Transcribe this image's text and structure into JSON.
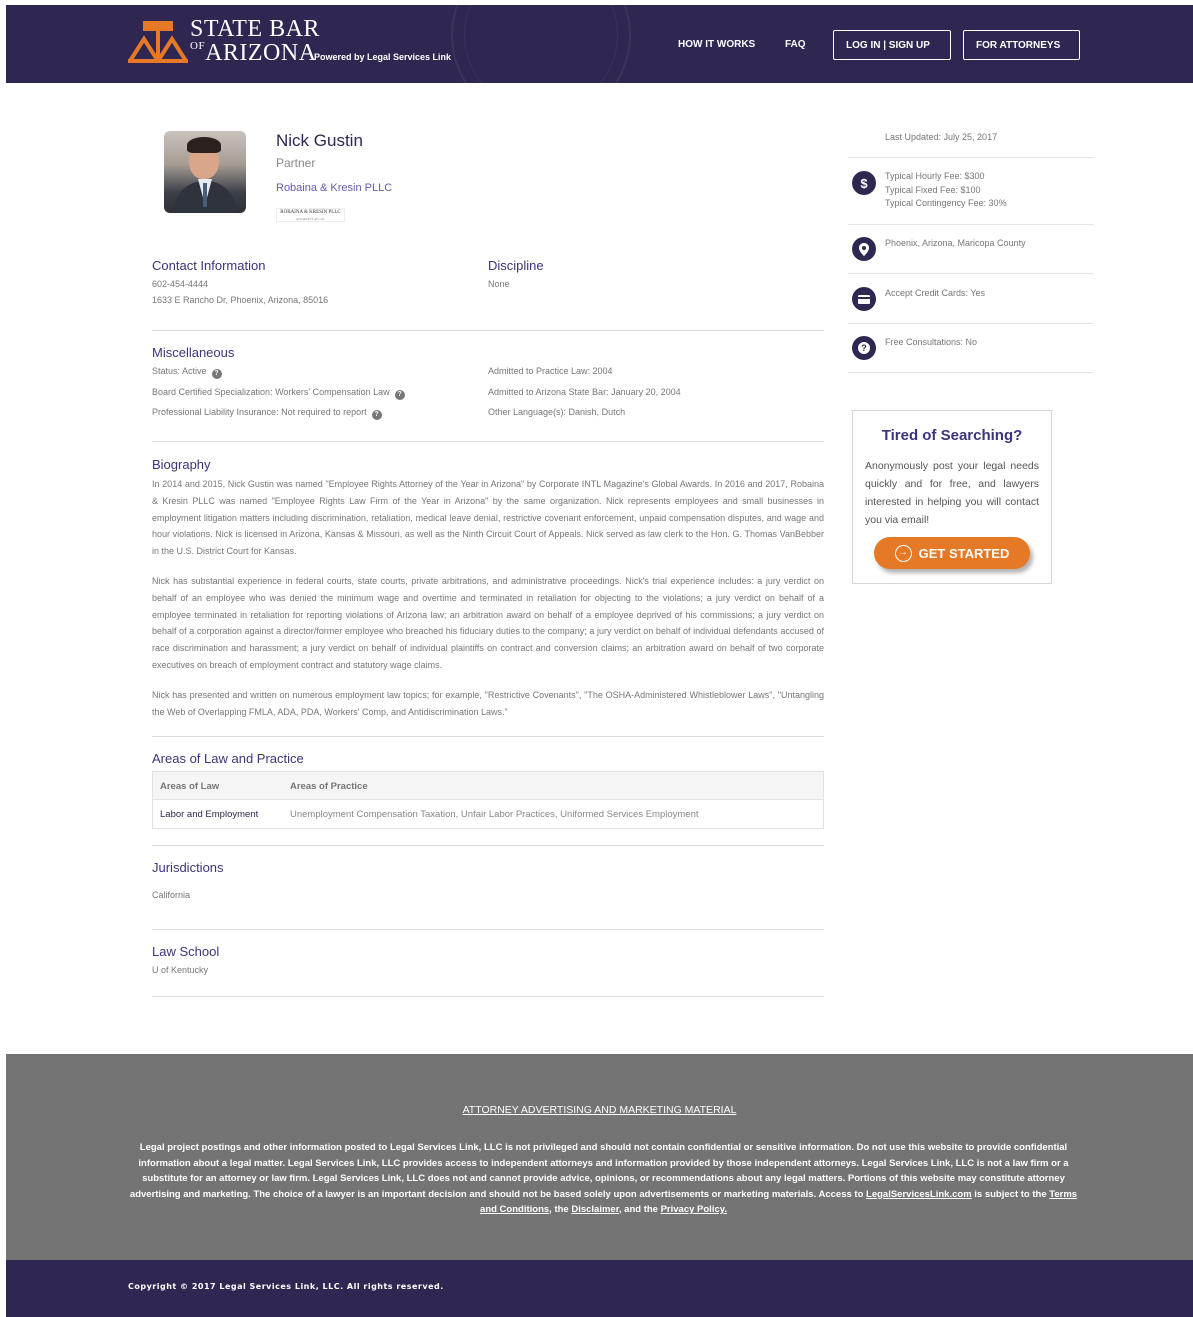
{
  "header": {
    "logo_line1": "STATE BAR",
    "logo_of": "OF",
    "logo_line2": "ARIZONA",
    "powered_by": "Powered by Legal Services Link",
    "nav_how": "HOW IT WORKS",
    "nav_faq": "FAQ",
    "login_label": "LOG IN | SIGN UP",
    "attorney_label": "FOR ATTORNEYS",
    "accent": "#2f2751"
  },
  "profile": {
    "name": "Nick Gustin",
    "role": "Partner",
    "firm": "Robaina & Kresin PLLC",
    "firm_logo_text": "ROBAINA & KRESIN PLLC",
    "firm_logo_sub": "ATTORNEYS AT LAW"
  },
  "contact": {
    "title": "Contact Information",
    "phone": "602-454-4444",
    "address": "1633 E Rancho Dr, Phoenix, Arizona, 85016"
  },
  "discipline": {
    "title": "Discipline",
    "value": "None"
  },
  "misc": {
    "title": "Miscellaneous",
    "status": "Status: Active",
    "certified": "Board Certified Specialization: Workers' Compensation Law",
    "insurance": "Professional Liability Insurance: Not required to report",
    "admitted_practice": "Admitted to Practice Law: 2004",
    "admitted_bar": "Admitted to Arizona State Bar: January 20, 2004",
    "languages": "Other Language(s): Danish, Dutch"
  },
  "biography": {
    "title": "Biography",
    "p1": "In 2014 and 2015, Nick Gustin was named \"Employee Rights Attorney of the Year in Arizona\" by Corporate INTL Magazine's Global Awards. In 2016 and 2017, Robaina & Kresin PLLC was named \"Employee Rights Law Firm of the Year in Arizona\" by the same organization.  Nick represents employees and small businesses in employment litigation matters including discrimination, retaliation, medical leave denial, restrictive covenant enforcement, unpaid compensation disputes, and wage and hour violations. Nick is licensed in Arizona, Kansas & Missouri, as well as the Ninth Circuit Court of Appeals. Nick served as law clerk to the Hon. G. Thomas VanBebber in the U.S. District Court for Kansas.",
    "p2": "Nick has substantial experience in federal courts, state courts, private arbitrations, and administrative proceedings. Nick's trial experience includes: a jury verdict on behalf of an employee who was denied the minimum wage and overtime and terminated in retaliation for objecting to the violations; a jury verdict on behalf of a employee terminated in retaliation for reporting violations of Arizona law; an arbitration award on behalf of a employee deprived of his commissions; a jury verdict on behalf of a corporation against a director/former employee who breached his fiduciary duties to the company; a jury verdict on behalf of individual defendants accused of race discrimination and harassment; a jury verdict on behalf of individual plaintiffs on contract and conversion claims; an arbitration award on behalf of two corporate executives on breach of employment contract and statutory wage claims.",
    "p3": "Nick has presented and written on numerous employment law topics; for example, \"Restrictive Covenants\", \"The OSHA-Administered Whistleblower Laws\", \"Untangling the Web of Overlapping FMLA, ADA, PDA, Workers' Comp, and Antidiscrimination Laws.\""
  },
  "areas": {
    "title": "Areas of Law and Practice",
    "col1": "Areas of Law",
    "col2": "Areas of Practice",
    "rows": [
      {
        "law": "Labor and Employment",
        "practice": "Unemployment Compensation Taxation, Unfair Labor Practices, Uniformed Services Employment"
      }
    ]
  },
  "jurisdictions": {
    "title": "Jurisdictions",
    "value": "California"
  },
  "law_school": {
    "title": "Law School",
    "value": "U of Kentucky"
  },
  "sidebar": {
    "updated": "Last Updated: July 25, 2017",
    "fee_hourly": "Typical Hourly Fee: $300",
    "fee_fixed": "Typical Fixed Fee: $100",
    "fee_contingency": "Typical Contingency Fee: 30%",
    "location": "Phoenix, Arizona, Maricopa County",
    "credit": "Accept Credit Cards: Yes",
    "consult": "Free Consultations: No",
    "icons": [
      "dollar-icon",
      "location-pin-icon",
      "credit-card-icon",
      "help-icon"
    ]
  },
  "promo": {
    "title": "Tired of Searching?",
    "text": "Anonymously post your legal needs quickly and for free, and lawyers interested in helping you will contact you via email!",
    "cta": "GET STARTED",
    "cta_color": "#e57926"
  },
  "footer": {
    "title": "ATTORNEY ADVERTISING AND MARKETING MATERIAL",
    "text_a": "Legal project postings and other information posted to Legal Services Link, LLC is not privileged and should not contain confidential or sensitive information. Do not use this website to provide confidential information about a legal matter. Legal Services Link, LLC provides access to independent attorneys and information provided by those independent attorneys. Legal Services Link, LLC is not a law firm or a substitute for an attorney or law firm. Legal Services Link, LLC does not and cannot provide advice, opinions, or recommendations about any legal matters. Portions of this website may constitute attorney advertising and marketing. The choice of a lawyer is an important decision and should not be based solely upon advertisements or marketing materials. Access to ",
    "link_site": "LegalServicesLink.com",
    "text_b": " is subject to the ",
    "link_terms": "Terms and Conditions",
    "text_c": ", the ",
    "link_disclaimer": "Disclaimer",
    "text_d": ", and the ",
    "link_privacy": "Privacy Policy.",
    "copyright": "Copyright © 2017 Legal Services Link, LLC. All rights reserved."
  }
}
